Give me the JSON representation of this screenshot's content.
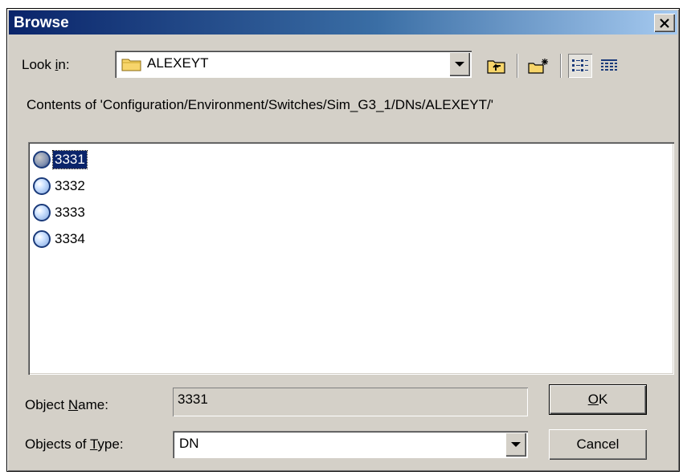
{
  "window": {
    "title": "Browse",
    "close_label": "✕"
  },
  "look_in": {
    "label_pre": "Look ",
    "label_accel": "i",
    "label_post": "n:",
    "value": "ALEXEYT",
    "icon": "folder-icon"
  },
  "toolbar": {
    "up_one_level": "up-folder-icon",
    "new_folder": "new-folder-icon",
    "list_view": "list-view-icon",
    "details_view": "details-view-icon"
  },
  "contents_text": "Contents of 'Configuration/Environment/Switches/Sim_G3_1/DNs/ALEXEYT/'",
  "items": [
    {
      "label": "3331",
      "selected": true
    },
    {
      "label": "3332",
      "selected": false
    },
    {
      "label": "3333",
      "selected": false
    },
    {
      "label": "3334",
      "selected": false
    }
  ],
  "object_name": {
    "label_pre": "Object ",
    "label_accel": "N",
    "label_post": "ame:",
    "value": "3331"
  },
  "object_type": {
    "label_pre": "Objects of ",
    "label_accel": "T",
    "label_post": "ype:",
    "value": "DN"
  },
  "buttons": {
    "ok_accel": "O",
    "ok_rest": "K",
    "cancel": "Cancel"
  },
  "colors": {
    "title_bar": "#0a246a",
    "face": "#d4d0c8",
    "selection": "#0a246a"
  }
}
